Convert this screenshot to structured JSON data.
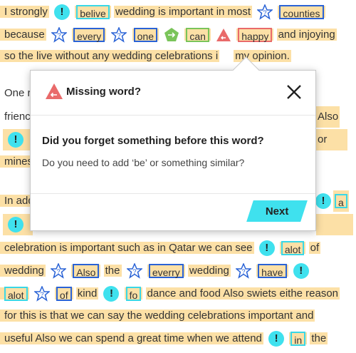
{
  "colors": {
    "highlight": "#fce0a6",
    "cyan": "#3fe1ee",
    "blue": "#2a63d6",
    "green": "#7ac45a",
    "red": "#e96a6a"
  },
  "essay": {
    "l1": {
      "t1": "I strongly",
      "w1": "belive",
      "t2": "wedding is important in most",
      "w2": "counties"
    },
    "l2": {
      "t1": "because",
      "w1": "every",
      "w2": "one",
      "w3": "can",
      "w4": "happy",
      "t2": "and injoying"
    },
    "l3": {
      "t1": "so the live without any wedding celebrations i",
      "t2": "my opinion."
    },
    "l4": {
      "t1": "One r"
    },
    "l5": {
      "t1": "frienc",
      "t2": "Also"
    },
    "l6": {
      "t2": "or"
    },
    "l7": {
      "t1": "mines"
    },
    "l8": {
      "t1": "In add",
      "w1": "a"
    },
    "l10": {
      "t1": "celebration is important such as in Qatar we can see",
      "w1": "alot",
      "t2": "of"
    },
    "l11": {
      "t1": "wedding",
      "w1": "Also",
      "t2": "the",
      "w2": "everry",
      "t3": "wedding",
      "w3": "have"
    },
    "l12": {
      "w1": "alot",
      "w2": "of",
      "t1": "kind",
      "w3": "fo",
      "t2": "dance and food Also swiets eithe reason"
    },
    "l13": {
      "t1": "for this is that we can say the wedding celebrations important and"
    },
    "l14": {
      "t1": "useful Also we can spend a great time when we attend",
      "w1": "in",
      "t2": "the"
    }
  },
  "modal": {
    "title": "Missing word?",
    "question": "Did you forget something before this word?",
    "hint": "Do you need to add ‘be’ or something similar?",
    "next_label": "Next",
    "close_icon": "close-icon",
    "title_icon": "missing-word-icon"
  }
}
